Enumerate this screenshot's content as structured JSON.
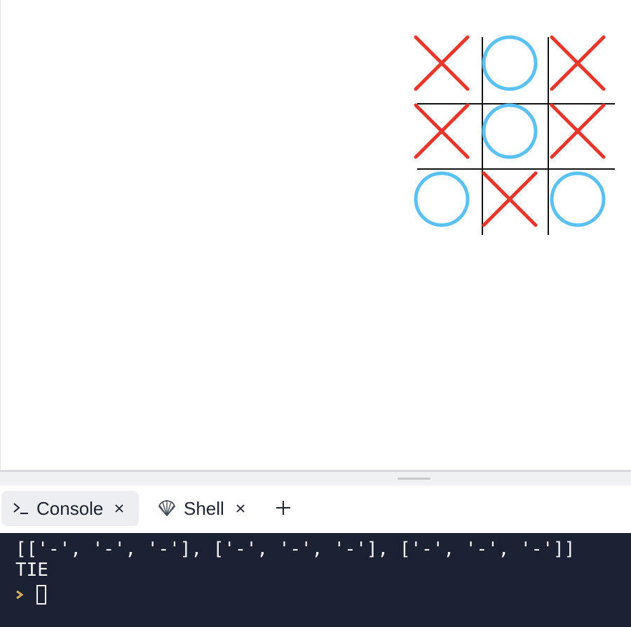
{
  "board": {
    "cells": [
      [
        "X",
        "O",
        "X"
      ],
      [
        "X",
        "O",
        "X"
      ],
      [
        "O",
        "X",
        "O"
      ]
    ],
    "colors": {
      "x": "#e8372a",
      "o": "#5bc0f3",
      "grid": "#111111"
    }
  },
  "panel": {
    "tabs": [
      {
        "label": "Console",
        "icon": "terminal-icon",
        "active": true
      },
      {
        "label": "Shell",
        "icon": "shell-icon",
        "active": false
      }
    ],
    "add_tab_icon": "plus-icon"
  },
  "console": {
    "output": [
      "[['-', '-', '-'], ['-', '-', '-'], ['-', '-', '-']]",
      "TIE"
    ],
    "prompt_icon": "prompt-chevron-icon",
    "colors": {
      "background": "#1c2133",
      "text": "#f4f5f7",
      "prompt": "#d3b25d"
    }
  }
}
